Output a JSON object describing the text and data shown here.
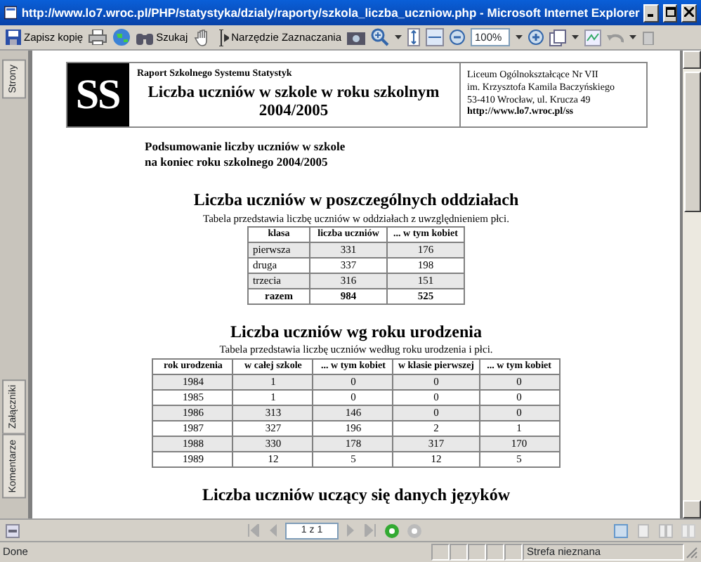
{
  "window": {
    "title": "http://www.lo7.wroc.pl/PHP/statystyka/dzialy/raporty/szkola_liczba_uczniow.php - Microsoft Internet Explorer"
  },
  "toolbar": {
    "save_label": "Zapisz kopię",
    "search_label": "Szukaj",
    "select_label": "Narzędzie Zaznaczania",
    "zoom_value": "100%"
  },
  "side_panel": {
    "tabs": [
      {
        "label": "Strony",
        "selected": false
      },
      {
        "label": "Załączniki",
        "selected": false
      },
      {
        "label": "Komentarze",
        "selected": false
      }
    ]
  },
  "document": {
    "header": {
      "logo": "SS",
      "subtitle": "Raport Szkolnego Systemu Statystyk",
      "title": "Liczba uczniów w szkole w roku szkolnym 2004/2005",
      "address": [
        "Liceum Ogólnokształcące Nr VII",
        "im. Krzysztofa Kamila Baczyńskiego",
        "53-410 Wrocław, ul. Krucza 49",
        "http://www.lo7.wroc.pl/ss"
      ]
    },
    "summary": [
      "Podsumowanie liczby uczniów w szkole",
      "na koniec roku szkolnego 2004/2005"
    ],
    "sections": [
      {
        "heading": "Liczba uczniów w poszczególnych oddziałach",
        "caption": "Tabela przedstawia liczbę uczniów w oddziałach z uwzględnieniem płci.",
        "table": {
          "columns": [
            "klasa",
            "liczba uczniów",
            "... w tym kobiet"
          ],
          "rows": [
            {
              "kind": "data",
              "cells": [
                "pierwsza",
                "331",
                "176"
              ]
            },
            {
              "kind": "data",
              "cells": [
                "druga",
                "337",
                "198"
              ]
            },
            {
              "kind": "data",
              "cells": [
                "trzecia",
                "316",
                "151"
              ]
            },
            {
              "kind": "total",
              "cells": [
                "razem",
                "984",
                "525"
              ]
            }
          ]
        }
      },
      {
        "heading": "Liczba uczniów wg roku urodzenia",
        "caption": "Tabela przedstawia liczbę uczniów według roku urodzenia i płci.",
        "table": {
          "columns": [
            "rok urodzenia",
            "w całej szkole",
            "... w tym kobiet",
            "w klasie pierwszej",
            "... w tym kobiet"
          ],
          "rows": [
            {
              "kind": "data",
              "cells": [
                "1984",
                "1",
                "0",
                "0",
                "0"
              ]
            },
            {
              "kind": "data",
              "cells": [
                "1985",
                "1",
                "0",
                "0",
                "0"
              ]
            },
            {
              "kind": "data",
              "cells": [
                "1986",
                "313",
                "146",
                "0",
                "0"
              ]
            },
            {
              "kind": "data",
              "cells": [
                "1987",
                "327",
                "196",
                "2",
                "1"
              ]
            },
            {
              "kind": "data",
              "cells": [
                "1988",
                "330",
                "178",
                "317",
                "170"
              ]
            },
            {
              "kind": "data",
              "cells": [
                "1989",
                "12",
                "5",
                "12",
                "5"
              ]
            }
          ]
        }
      },
      {
        "heading": "Liczba uczniów uczący się danych języków"
      }
    ]
  },
  "page_nav": {
    "page_field": "1 z 1"
  },
  "status_bar": {
    "text": "Done",
    "zone": "Strefa nieznana"
  }
}
